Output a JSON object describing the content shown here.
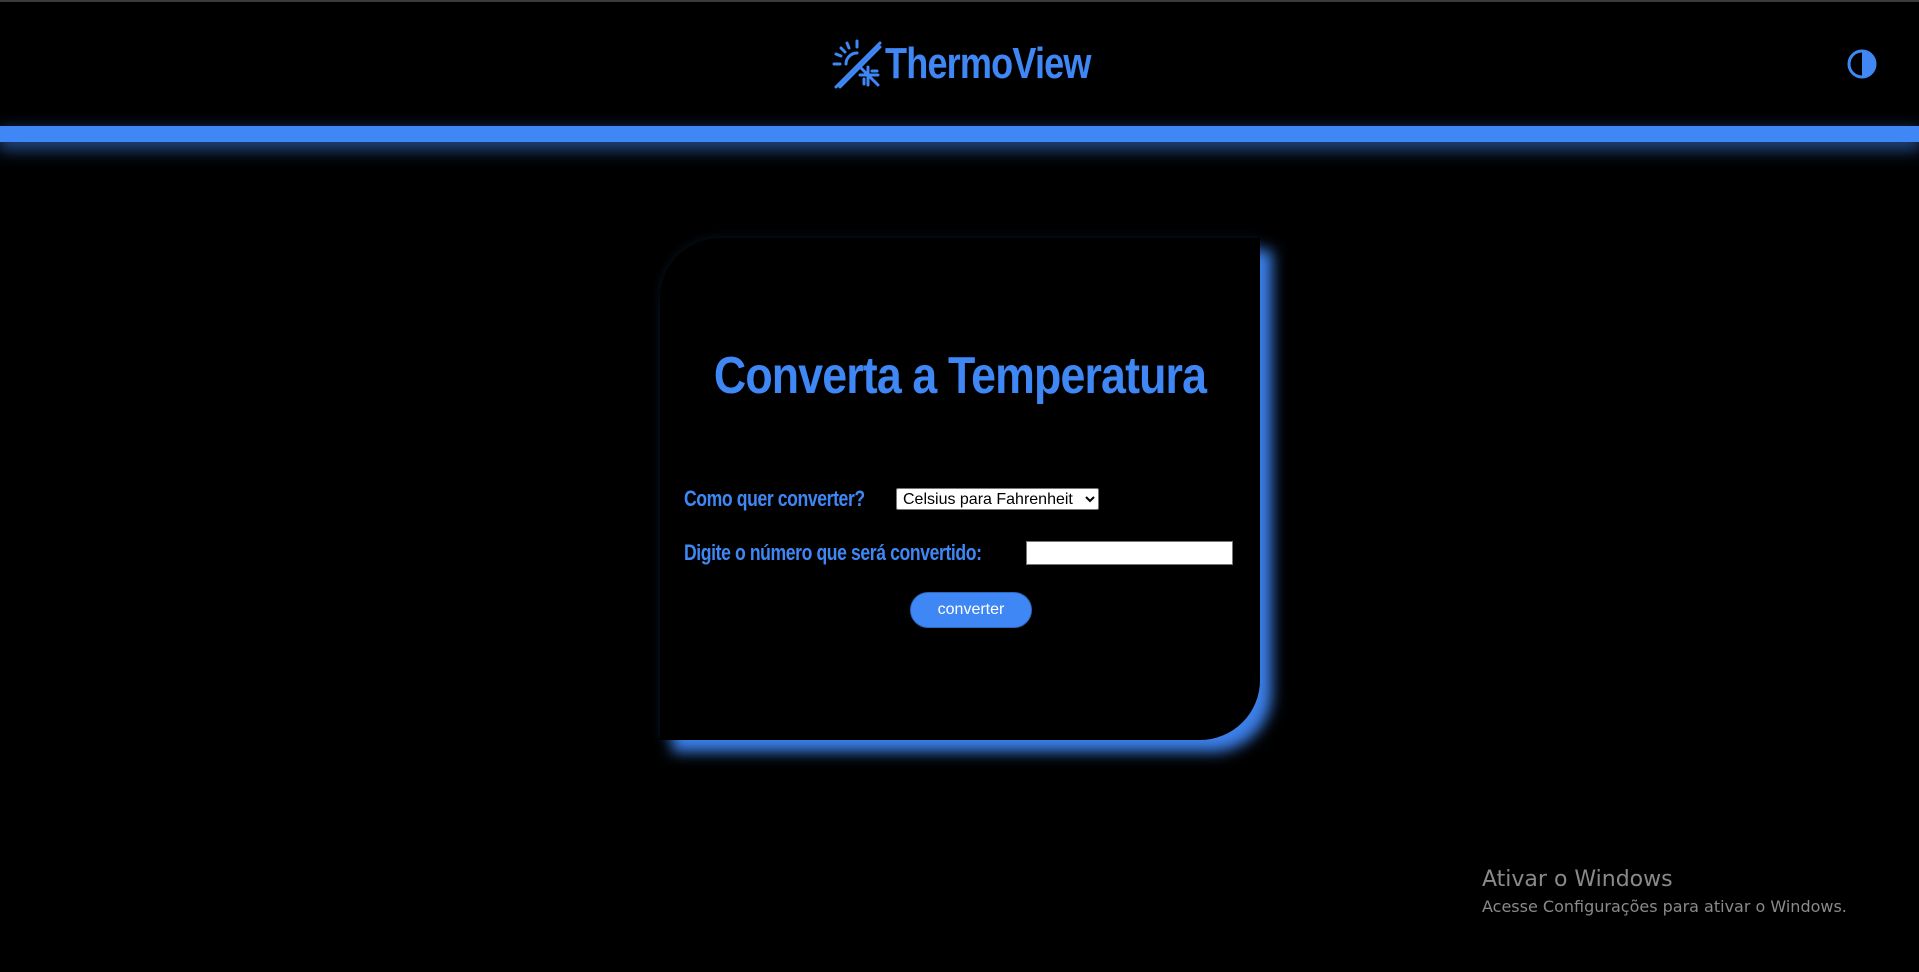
{
  "header": {
    "brand_name": "ThermoView",
    "brand_icon": "sun-snowflake-icon",
    "theme_toggle_icon": "contrast-icon"
  },
  "converter": {
    "title": "Converta a Temperatura",
    "mode_label": "Como quer converter?",
    "mode_selected": "Celsius para Fahrenheit",
    "number_label": "Digite o número que será convertido:",
    "number_value": "",
    "convert_button": "converter"
  },
  "watermark": {
    "title": "Ativar o Windows",
    "subtitle": "Acesse Configurações para ativar o Windows."
  },
  "colors": {
    "accent": "#3f87f5",
    "background": "#000000"
  }
}
